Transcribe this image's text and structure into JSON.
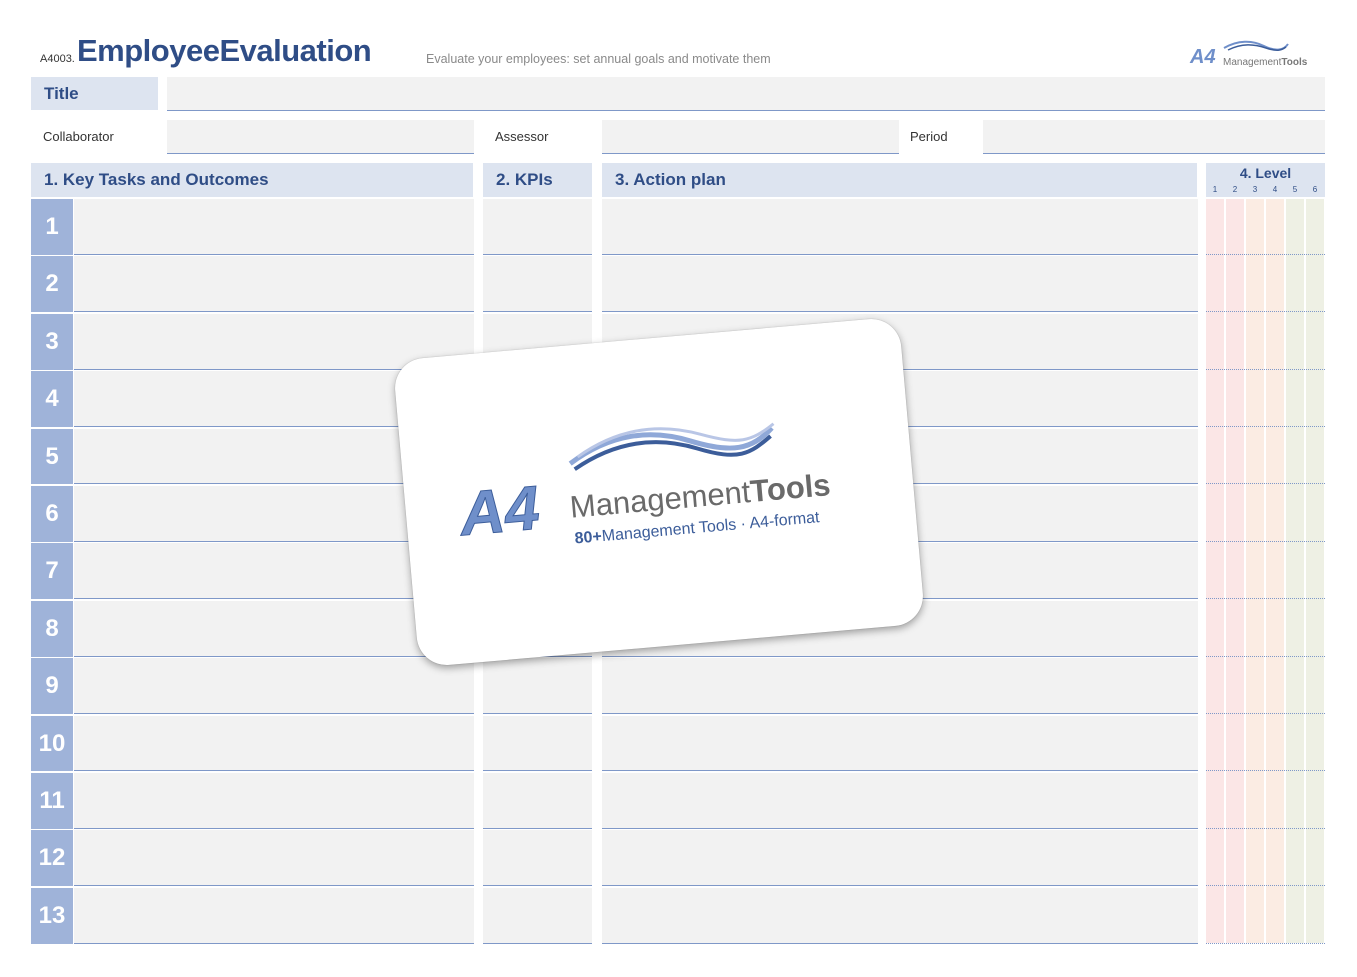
{
  "header": {
    "code": "A4003.",
    "title": "EmployeeEvaluation",
    "subtitle": "Evaluate your employees: set annual goals and motivate them",
    "brand_logo": "A4 ManagementTools",
    "brand_small_text": "Management",
    "brand_small_bold": "Tools"
  },
  "fields": {
    "title_label": "Title",
    "collaborator_label": "Collaborator",
    "assessor_label": "Assessor",
    "period_label": "Period"
  },
  "columns": {
    "tasks": "1. Key Tasks and Outcomes",
    "kpis": "2. KPIs",
    "action": "3. Action plan",
    "level": "4. Level",
    "level_numbers": [
      "1",
      "2",
      "3",
      "4",
      "5",
      "6"
    ]
  },
  "rows": [
    "1",
    "2",
    "3",
    "4",
    "5",
    "6",
    "7",
    "8",
    "9",
    "10",
    "11",
    "12",
    "13"
  ],
  "card": {
    "logo_a4": "A4",
    "logo_management": "Management",
    "logo_tools": "Tools",
    "tagline_bold": "80+",
    "tagline_rest": "Management Tools · A4-format"
  },
  "colors": {
    "accent": "#2f4d86",
    "header_fill": "#dde4f0",
    "number_fill": "#9fb3d9",
    "cell_fill": "#f2f2f2",
    "level_stripes": [
      "#fbe6e6",
      "#fbe6e6",
      "#fbece3",
      "#fbece3",
      "#eef0e4",
      "#eef0e4"
    ]
  }
}
